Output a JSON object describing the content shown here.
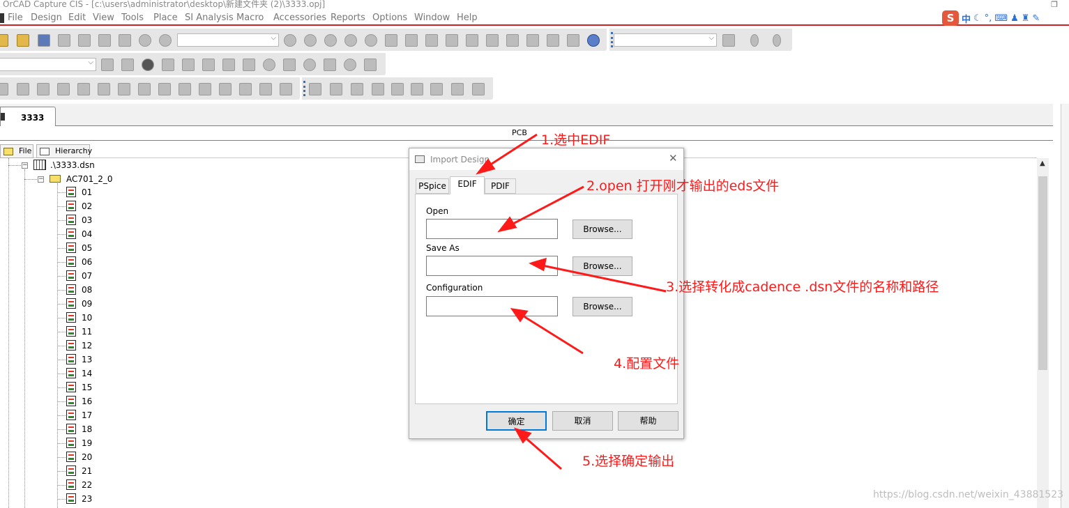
{
  "window": {
    "title": "OrCAD Capture CIS - [c:\\users\\administrator\\desktop\\新建文件夹 (2)\\3333.opj]"
  },
  "menu": [
    "File",
    "Design",
    "Edit",
    "View",
    "Tools",
    "Place",
    "SI Analysis",
    "Macro",
    "Accessories",
    "Reports",
    "Options",
    "Window",
    "Help"
  ],
  "ime": {
    "logo": "S",
    "mode": "中"
  },
  "session": {
    "tab_label": "3333"
  },
  "pcb_strip": {
    "label": "PCB"
  },
  "project_tabs": {
    "file": "File",
    "hierarchy": "Hierarchy"
  },
  "tree": {
    "root": ".\\3333.dsn",
    "folder": "AC701_2_0",
    "pages": [
      "01",
      "02",
      "03",
      "04",
      "05",
      "06",
      "07",
      "08",
      "09",
      "10",
      "11",
      "12",
      "13",
      "14",
      "15",
      "16",
      "17",
      "18",
      "19",
      "20",
      "21",
      "22",
      "23"
    ]
  },
  "dialog": {
    "title": "Import Design",
    "close": "✕",
    "tabs": [
      "PSpice",
      "EDIF",
      "PDIF"
    ],
    "active_tab": "EDIF",
    "fields": {
      "open_label": "Open",
      "save_as_label": "Save As",
      "config_label": "Configuration",
      "browse": "Browse..."
    },
    "buttons": {
      "ok": "确定",
      "cancel": "取消",
      "help": "帮助"
    }
  },
  "annotations": {
    "step1": "1.选中EDIF",
    "step2": "2.open 打开刚才输出的eds文件",
    "step3": "3.选择转化成cadence .dsn文件的名称和路径",
    "step4": "4.配置文件",
    "step5": "5.选择确定输出"
  },
  "watermark": "https://blog.csdn.net/weixin_43881523",
  "colors": {
    "annotation": "#ff1a1a",
    "menu_underline": "#cc2222",
    "primary_border": "#0078d7"
  }
}
